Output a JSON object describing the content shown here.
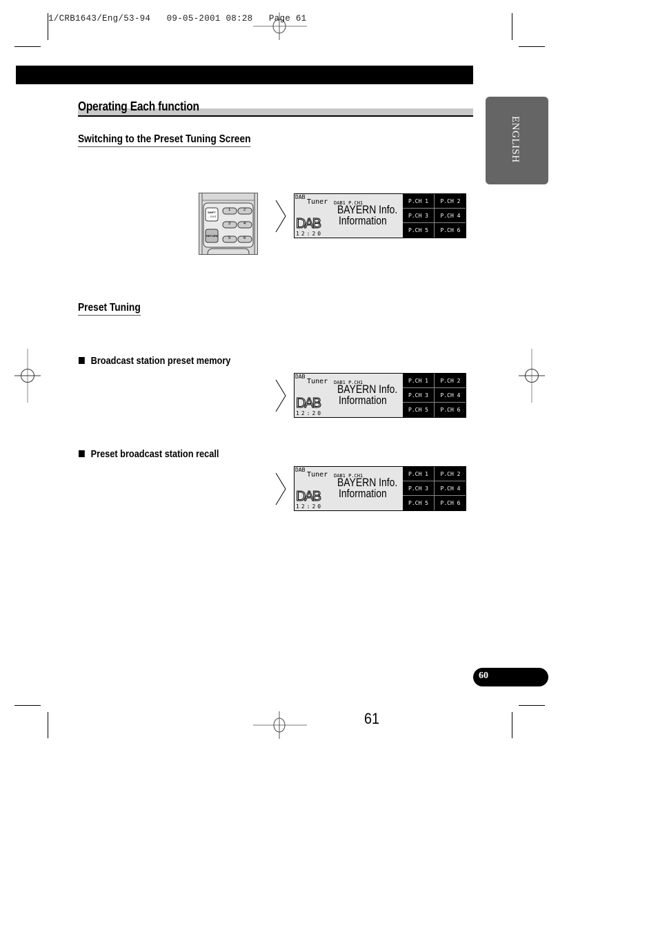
{
  "print_header": "1/CRB1643/Eng/53-94   09-05-2001 08:28   Page 61",
  "section": {
    "title": "Operating Each function"
  },
  "language_tab": "ENGLISH",
  "subsections": [
    {
      "title": "Switching to the Preset Tuning Screen"
    },
    {
      "title": "Preset Tuning"
    }
  ],
  "bullets": [
    {
      "label": "Broadcast station preset memory"
    },
    {
      "label": "Preset broadcast station recall"
    }
  ],
  "remote": {
    "shift_label": "SHIFT",
    "shift_sub": "← EXIT",
    "return_label": "RETURN",
    "buttons": [
      "1",
      "2",
      "3",
      "4",
      "5",
      "6"
    ]
  },
  "display": {
    "source_small": "DAB",
    "source": "Tuner",
    "band_channel": "DAB1  P.CH1",
    "station_line1": "BAYERN Info.",
    "station_line2": "Information",
    "logo": "DAB",
    "clock": "12:20",
    "presets": [
      "P.CH 1",
      "P.CH 2",
      "P.CH 3",
      "P.CH 4",
      "P.CH 5",
      "P.CH 6"
    ]
  },
  "footer": {
    "page_pill": "60",
    "page_number": "61"
  },
  "colors": {
    "tab_grey": "#656565",
    "section_grey": "#c9c9c9",
    "lcd_bg": "#e6e6e6"
  }
}
